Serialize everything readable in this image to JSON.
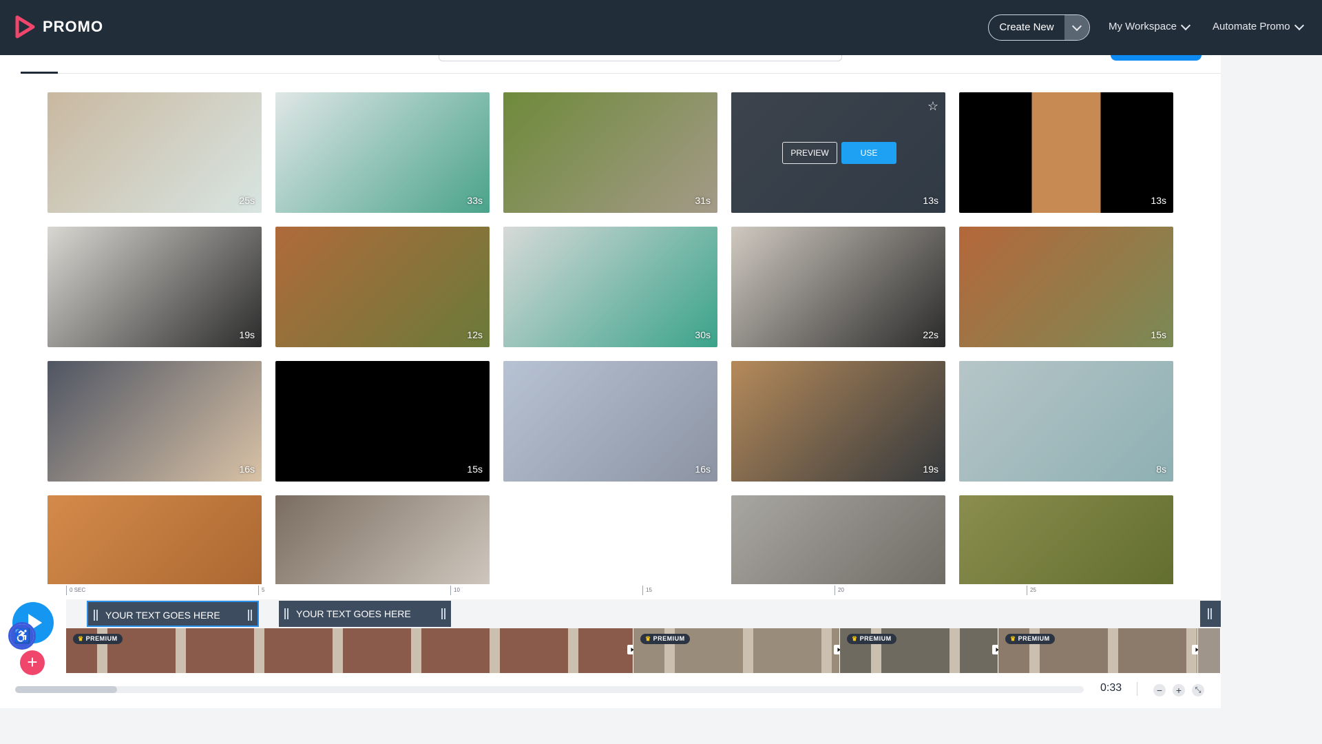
{
  "brand": {
    "name": "PROMO"
  },
  "nav": {
    "create_new": "Create New",
    "workspace": "My Workspace",
    "automate": "Automate Promo"
  },
  "hover": {
    "preview_label": "PREVIEW",
    "use_label": "USE",
    "star_icon": "star-outline-icon"
  },
  "videos": [
    {
      "duration": "25s",
      "colors": [
        "#c9b8a0",
        "#d8e5e2"
      ]
    },
    {
      "duration": "33s",
      "colors": [
        "#dfe6e6",
        "#4aa38a"
      ]
    },
    {
      "duration": "31s",
      "colors": [
        "#6e8a3a",
        "#a49a88"
      ]
    },
    {
      "duration": "13s",
      "colors": [
        "#555a5e",
        "#3f4a52"
      ]
    },
    {
      "duration": "13s",
      "colors": [
        "#000000",
        "#c78a52"
      ]
    },
    {
      "duration": "19s",
      "colors": [
        "#d9d7d2",
        "#2b2b2b"
      ]
    },
    {
      "duration": "12s",
      "colors": [
        "#b06a3a",
        "#6a7a3a"
      ]
    },
    {
      "duration": "30s",
      "colors": [
        "#d7d9d8",
        "#3aa38a"
      ]
    },
    {
      "duration": "22s",
      "colors": [
        "#cfc9c0",
        "#2a2a2a"
      ]
    },
    {
      "duration": "15s",
      "colors": [
        "#b5673a",
        "#7a8a55"
      ]
    },
    {
      "duration": "16s",
      "colors": [
        "#4f5563",
        "#d9c2a6"
      ]
    },
    {
      "duration": "15s",
      "colors": [
        "#000000",
        "#000000"
      ]
    },
    {
      "duration": "16s",
      "colors": [
        "#b7c2d3",
        "#8c94a3"
      ]
    },
    {
      "duration": "19s",
      "colors": [
        "#b58a5a",
        "#34383c"
      ]
    },
    {
      "duration": "8s",
      "colors": [
        "#b6c5c8",
        "#8eb0b3"
      ]
    },
    {
      "duration": "",
      "colors": [
        "#d48a4a",
        "#a7642f"
      ]
    },
    {
      "duration": "",
      "colors": [
        "#7a6c60",
        "#d7d0c7"
      ]
    },
    {
      "duration": "",
      "colors": [
        "#ffffff",
        "#ffffff"
      ]
    },
    {
      "duration": "",
      "colors": [
        "#a9a7a1",
        "#6a6660"
      ]
    },
    {
      "duration": "",
      "colors": [
        "#8a8d4e",
        "#5e6b2c"
      ]
    }
  ],
  "timeline": {
    "ruler": [
      "0 SEC",
      "5",
      "10",
      "15",
      "20",
      "25"
    ],
    "text_clips": [
      "YOUR TEXT GOES HERE",
      "YOUR TEXT GOES HERE"
    ],
    "premium_label": "PREMIUM",
    "duration": "0:33",
    "clip_colors": [
      "#8a5a4a",
      "#9a8c7a",
      "#6e6a60",
      "#8c7a6a",
      "#a0958a"
    ]
  }
}
